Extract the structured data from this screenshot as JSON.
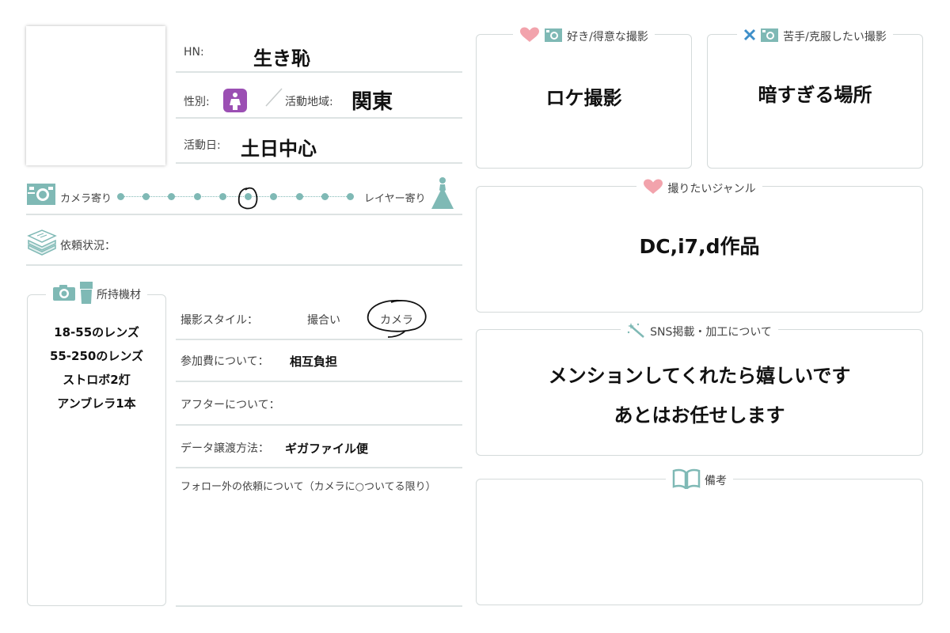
{
  "profile": {
    "hn_label": "HN:",
    "hn_value": "生き恥",
    "gender_label": "性別:",
    "gender_icon": "female-symbol-icon",
    "area_label": "活動地域:",
    "area_value": "関東",
    "days_label": "活動日:",
    "days_value": "土日中心"
  },
  "slider": {
    "left_label": "カメラ寄り",
    "right_label": "レイヤー寄り",
    "dot_count": 10,
    "selected_index": 5
  },
  "request_status": {
    "label": "依頼状況："
  },
  "equipment": {
    "title": "所持機材",
    "items": [
      "18-55のレンズ",
      "55-250のレンズ",
      "ストロボ2灯",
      "アンブレラ1本"
    ]
  },
  "style": {
    "label": "撮影スタイル：",
    "option_1": "撮合い",
    "option_2": "カメラ",
    "selected": "カメラ"
  },
  "fee": {
    "label": "参加費について：",
    "value": "相互負担"
  },
  "after": {
    "label": "アフターについて：",
    "value": ""
  },
  "data_transfer": {
    "label": "データ譲渡方法：",
    "value": "ギガファイル便"
  },
  "non_follower": {
    "label": "フォロー外の依頼について（カメラに○ついてる限り）"
  },
  "favorite": {
    "title": "好き/得意な撮影",
    "value": "ロケ撮影"
  },
  "weakness": {
    "title": "苦手/克服したい撮影",
    "value": "暗すぎる場所"
  },
  "genre": {
    "title": "撮りたいジャンル",
    "value": "DC,i7,d作品"
  },
  "sns": {
    "title": "SNS掲載・加工について",
    "line_1": "メンションしてくれたら嬉しいです",
    "line_2": "あとはお任せします"
  },
  "notes": {
    "title": "備考"
  },
  "colors": {
    "accent": "#7fb9b5",
    "heart": "#f2a3ac",
    "border": "#d4dada",
    "gender_bg": "#9b4fb3"
  }
}
